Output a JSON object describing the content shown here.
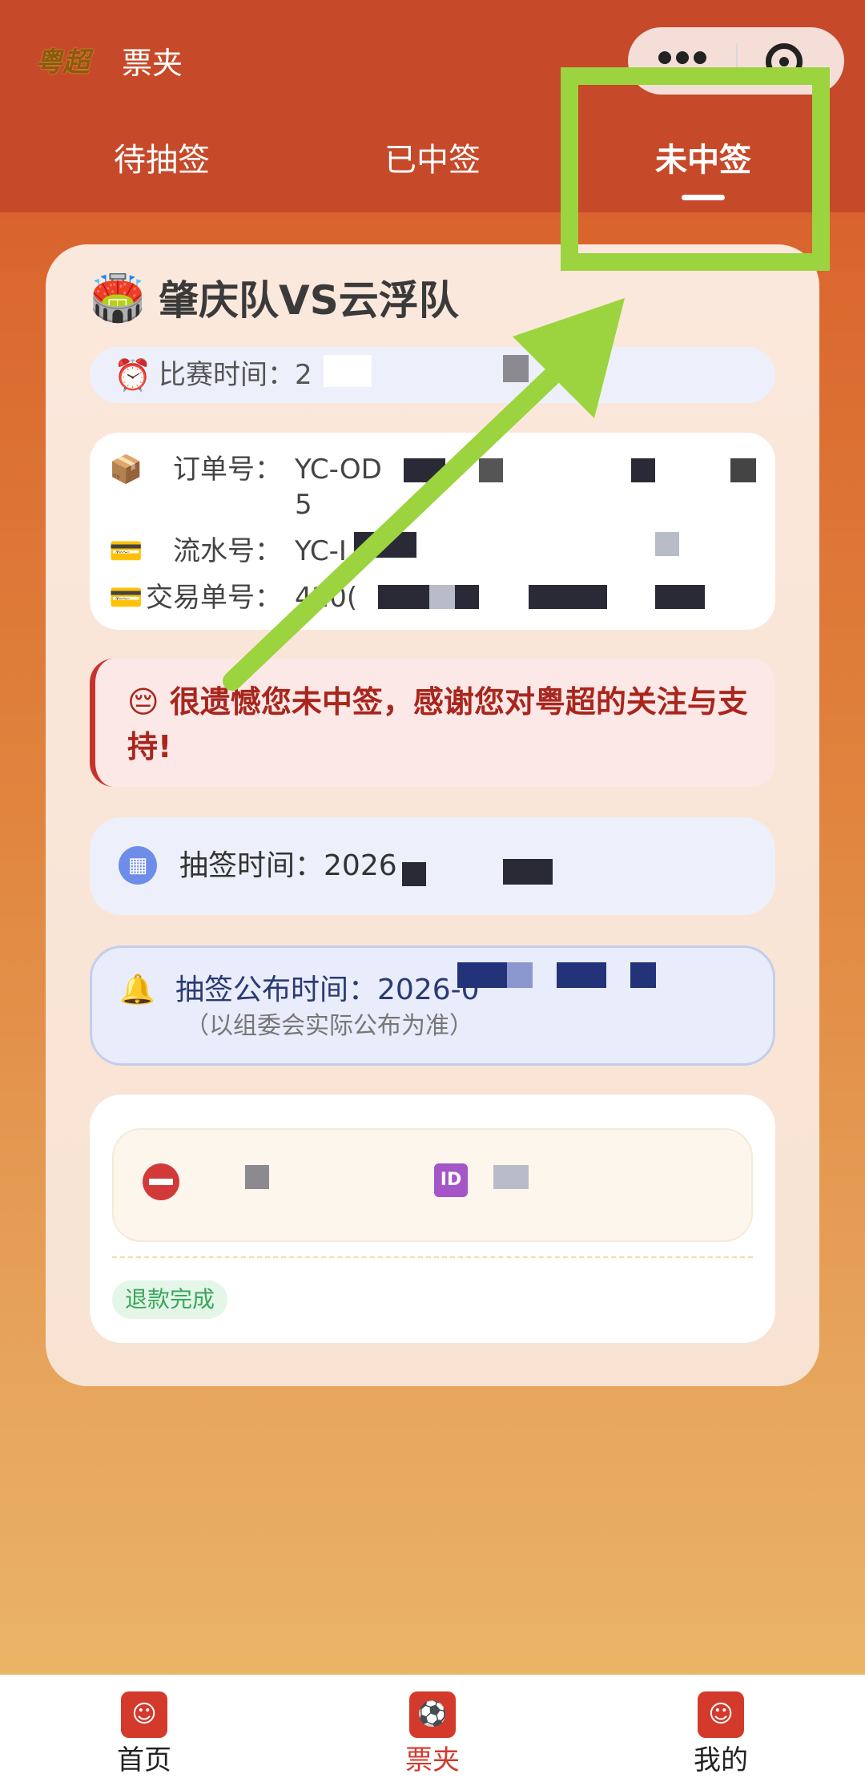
{
  "header": {
    "logo_text": "粤超",
    "title": "票夹",
    "tabs": [
      {
        "label": "待抽签"
      },
      {
        "label": "已中签"
      },
      {
        "label": "未中签"
      }
    ],
    "active_tab": "未中签"
  },
  "card": {
    "match_title": "肇庆队VS云浮队",
    "match_time_label": "比赛时间：",
    "match_time_value": "2",
    "order_no_label": "订单号：",
    "order_no_value": "YC-OD",
    "order_no_line2": "5",
    "serial_no_label": "流水号：",
    "serial_no_value": "YC-I",
    "trade_no_label": "交易单号：",
    "trade_no_value": "420(",
    "fail_message": "😔 很遗憾您未中签，感谢您对粤超的关注与支持!",
    "draw_time_label": "抽签时间：",
    "draw_time_value": "2026",
    "announce_time_label": "抽签公布时间：",
    "announce_time_value": "2026-0",
    "announce_note": "（以组委会实际公布为准）",
    "refund_status": "退款完成",
    "id_badge_text": "ID"
  },
  "bottom_nav": [
    {
      "label": "首页",
      "icon": "lion-dance-icon"
    },
    {
      "label": "票夹",
      "icon": "ticket-wallet-icon",
      "active": true
    },
    {
      "label": "我的",
      "icon": "lion-dance-icon"
    }
  ],
  "colors": {
    "header_bg": "#c6492a",
    "accent": "#d33a2c",
    "annotation": "#9bd43e",
    "fail_text": "#a8261e"
  }
}
